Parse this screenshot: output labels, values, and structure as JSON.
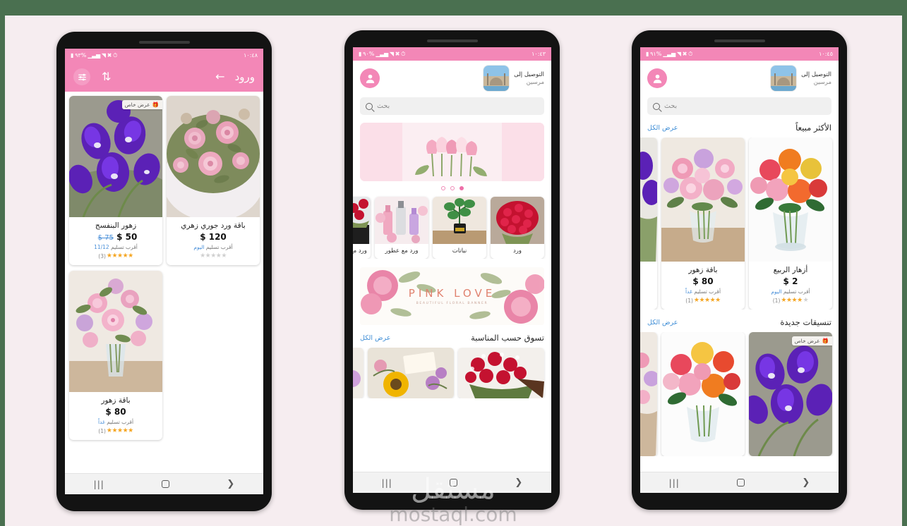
{
  "app": {
    "watermark_ar": "مستقل",
    "watermark_en": "mostaql.com"
  },
  "colors": {
    "accent_pink": "#f387b7",
    "link_blue": "#3f8ed6",
    "star_gold": "#f5a623",
    "page_bg": "#f6edf0",
    "outer_border": "#4a7050"
  },
  "phones": [
    {
      "id": "phone-listing",
      "status_bar": {
        "battery": "٩٣%",
        "time": "١٠:٤٨",
        "icons": [
          "battery-icon",
          "signal-icon",
          "wifi-icon",
          "mute-icon",
          "alarm-icon"
        ]
      },
      "appbar": {
        "title": "ورود",
        "back_icon": "arrow-left-icon",
        "sort_icon": "sort-icon",
        "filter_icon": "filter-icon"
      },
      "products": [
        {
          "name": "باقة ورد جوري زهري",
          "price": "$ 120",
          "old_price": "",
          "delivery_label": "أقرب تسليم",
          "delivery_value": "اليوم",
          "stars": 0,
          "reviews": "",
          "badge": ""
        },
        {
          "name": "زهور البنفسج",
          "price": "$ 50",
          "old_price": "$ 75",
          "delivery_label": "أقرب تسليم",
          "delivery_value": "11/12",
          "stars": 4.5,
          "reviews": "(3)",
          "badge": "عرض خاص"
        },
        {
          "name": "باقة زهور",
          "price": "$ 80",
          "old_price": "",
          "delivery_label": "أقرب تسليم",
          "delivery_value": "غداً",
          "stars": 5,
          "reviews": "(1)",
          "badge": ""
        }
      ]
    },
    {
      "id": "phone-home",
      "status_bar": {
        "battery": "٩٠%",
        "time": "١٠:٤٣"
      },
      "header": {
        "delivery_label": "التوصيل إلى",
        "delivery_city": "مرسين",
        "city_thumb_icon": "mosque-photo",
        "avatar_icon": "user-avatar-icon",
        "search_placeholder": "بحث",
        "search_value": "",
        "search_icon": "search-icon"
      },
      "carousel": {
        "dots": 3,
        "active_dot": 3
      },
      "categories": [
        {
          "label": "ورد"
        },
        {
          "label": "نباتات"
        },
        {
          "label": "ورد مع عطور"
        },
        {
          "label": "ورد مع"
        }
      ],
      "banner": {
        "title": "PINK LOVE",
        "subtitle": "BEAUTIFUL FLORAL BANNER"
      },
      "section": {
        "title": "تسوق حسب المناسبة",
        "link": "عرض الكل"
      }
    },
    {
      "id": "phone-best-sellers",
      "status_bar": {
        "battery": "٩١%",
        "time": "١٠:٤٥"
      },
      "header": {
        "delivery_label": "التوصيل إلى",
        "delivery_city": "مرسين",
        "search_placeholder": "بحث",
        "search_value": ""
      },
      "sections": [
        {
          "title": "الأكثر مبيعاً",
          "link": "عرض الكل",
          "products": [
            {
              "name": "أزهار الربيع",
              "price": "$ 2",
              "delivery_label": "أقرب تسليم",
              "delivery_value": "اليوم",
              "stars": 4,
              "reviews": "(1)",
              "badge": ""
            },
            {
              "name": "باقة زهور",
              "price": "$ 80",
              "delivery_label": "أقرب تسليم",
              "delivery_value": "غداً",
              "stars": 5,
              "reviews": "(1)",
              "badge": ""
            }
          ]
        },
        {
          "title": "تنسيقات جديدة",
          "link": "عرض الكل",
          "products": [
            {
              "name": "",
              "price": "",
              "badge": "عرض خاص"
            },
            {
              "name": "",
              "price": "",
              "badge": ""
            }
          ]
        }
      ]
    }
  ],
  "navbar": {
    "recents_icon": "recents-icon",
    "home_icon": "home-icon",
    "back_icon": "back-chevron-icon"
  }
}
